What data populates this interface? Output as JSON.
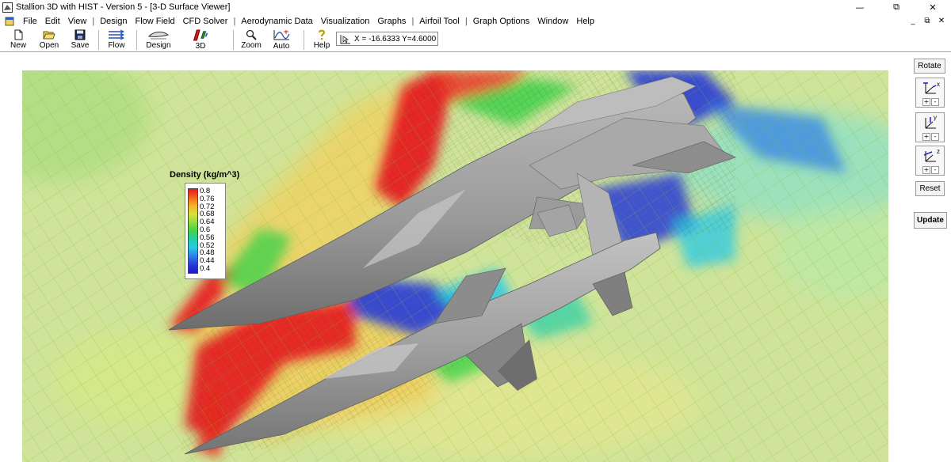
{
  "window": {
    "title": "Stallion 3D with HIST - Version 5 - [3-D Surface Viewer]",
    "minimize_glyph": "—",
    "maximize_glyph": "⧉",
    "close_glyph": "✕"
  },
  "menu": {
    "items": [
      "File",
      "Edit",
      "View",
      "|",
      "Design",
      "Flow Field",
      "CFD Solver",
      "|",
      "Aerodynamic Data",
      "Visualization",
      "Graphs",
      "|",
      "Airfoil Tool",
      "|",
      "Graph Options",
      "Window",
      "Help"
    ],
    "mdi_min": "_",
    "mdi_restore": "⧉",
    "mdi_close": "✕"
  },
  "toolbar": {
    "new": "New",
    "open": "Open",
    "save": "Save",
    "flow": "Flow",
    "design": "Design",
    "view3d": "3D",
    "zoom": "Zoom",
    "auto": "Auto",
    "help": "Help",
    "coords": "X = -16.6333  Y=4.6000"
  },
  "legend": {
    "title": "Density (kg/m^3)",
    "ticks": [
      "0.8",
      "0.76",
      "0.72",
      "0.68",
      "0.64",
      "0.6",
      "0.56",
      "0.52",
      "0.48",
      "0.44",
      "0.4"
    ],
    "colors": [
      "#e8141c",
      "#f06420",
      "#f5b42a",
      "#d9e03a",
      "#8fdc3c",
      "#3fd24a",
      "#22cfa8",
      "#28c8e6",
      "#2e7ee8",
      "#2a3cd8",
      "#1a1ac8"
    ]
  },
  "panel": {
    "rotate": "Rotate",
    "reset": "Reset",
    "update": "Update",
    "axis_x": "x",
    "axis_y": "y",
    "axis_z": "z",
    "plus": "+",
    "minus": "-"
  },
  "icons": {
    "app": "stallion-app-icon",
    "document": "document-icon",
    "new": "new-file-icon",
    "open": "open-folder-icon",
    "save": "floppy-disk-icon",
    "flow": "flow-lines-icon",
    "design": "airfoil-design-icon",
    "view3d": "3d-view-icon",
    "zoom": "magnifier-icon",
    "auto": "auto-scale-icon",
    "help": "help-question-icon",
    "cursor": "cursor-coordinates-icon"
  },
  "colors": {
    "background_field": "#cfe49a",
    "high_density": "#e8141c",
    "low_density": "#1a1ac8",
    "aircraft_surface": "#9c9c9c"
  }
}
